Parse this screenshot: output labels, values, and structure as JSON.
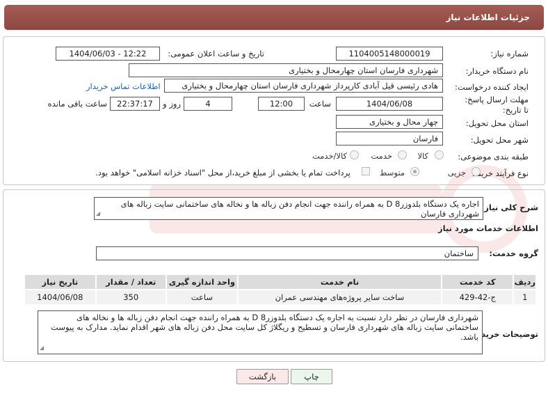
{
  "header": {
    "title": "جزئیات اطلاعات نیاز"
  },
  "form": {
    "need_number_label": "شماره نیاز:",
    "need_number": "1104005148000019",
    "announce_label": "تاریخ و ساعت اعلان عمومی:",
    "announce_value": "1404/06/03 - 12:22",
    "buyer_org_label": "نام دستگاه خریدار:",
    "buyer_org": "شهرداری فارسان استان چهارمحال و بختیاری",
    "creator_label": "ایجاد کننده درخواست:",
    "creator": "هادی رئیسی قیل آبادی کارپرداز شهرداری فارسان استان چهارمحال و بختیاری",
    "contact_link": "اطلاعات تماس خریدار",
    "deadline_label": "مهلت ارسال پاسخ: تا تاریخ:",
    "deadline_date": "1404/06/08",
    "time_label": "ساعت",
    "deadline_time": "12:00",
    "days": "4",
    "days_label": "روز و",
    "remaining": "22:37:17",
    "remaining_label": "ساعت باقی مانده",
    "province_label": "استان محل تحویل:",
    "province": "چهار محال و بختیاری",
    "city_label": "شهر محل تحویل:",
    "city": "فارسان",
    "category_label": "طبقه بندی موضوعی:",
    "cat_goods": "کالا",
    "cat_service": "خدمت",
    "cat_both": "کالا/خدمت",
    "process_label": "نوع فرآیند خرید :",
    "proc_partial": "جزیی",
    "proc_medium": "متوسط",
    "payment_note": "پرداخت تمام یا بخشی از مبلغ خرید،از محل \"اسناد خزانه اسلامی\" خواهد بود."
  },
  "details": {
    "summary_label": "شرح کلی نیاز:",
    "summary": "اجاره یک دستگاه بلدوزر8 D به همراه راننده جهت انجام دفن زباله ها و نخاله های ساختمانی سایت زباله های شهرداری فارسان",
    "services_title": "اطلاعات خدمات مورد نیاز",
    "group_label": "گروه خدمت:",
    "group": "ساختمان",
    "table": {
      "headers": [
        "ردیف",
        "کد خدمت",
        "نام خدمت",
        "واحد اندازه گیری",
        "تعداد / مقدار",
        "تاریخ نیاز"
      ],
      "rows": [
        [
          "1",
          "ج-42-429",
          "ساخت سایر پروژه‌های مهندسی عمران",
          "ساعت",
          "350",
          "1404/06/08"
        ]
      ]
    },
    "buyer_notes_label": "توضیحات خریدار:",
    "buyer_notes": "شهرداری فارسان در نظر دارد نسبت به اجاره یک دستگاه بلدوزر8 D به همراه راننده جهت انجام دفن زباله ها و نخاله های ساختمانی سایت زباله های شهرداری فارسان و تسطیح و ریگلاژ کل سایت محل دفن زباله های شهر اقدام نماید. مدارک به پیوست باشد."
  },
  "buttons": {
    "back": "بازگشت",
    "print": "چاپ"
  },
  "colors": {
    "header": "#9a524b",
    "link": "#1a5fb4"
  }
}
